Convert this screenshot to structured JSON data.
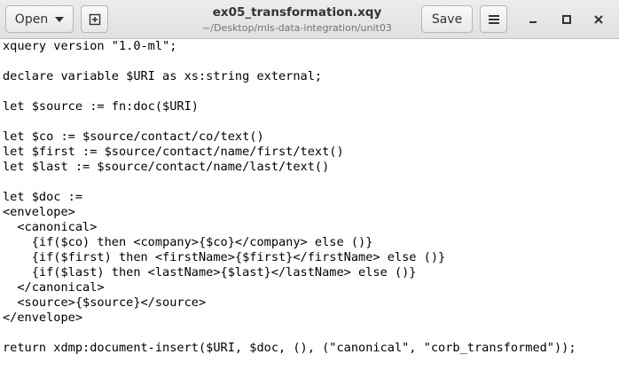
{
  "header": {
    "open_label": "Open",
    "title": "ex05_transformation.xqy",
    "subtitle": "~/Desktop/mls-data-integration/unit03",
    "save_label": "Save"
  },
  "editor": {
    "lines": [
      "xquery version \"1.0-ml\";",
      "",
      "declare variable $URI as xs:string external;",
      "",
      "let $source := fn:doc($URI)",
      "",
      "let $co := $source/contact/co/text()",
      "let $first := $source/contact/name/first/text()",
      "let $last := $source/contact/name/last/text()",
      "",
      "let $doc :=",
      "<envelope>",
      "  <canonical>",
      "    {if($co) then <company>{$co}</company> else ()}",
      "    {if($first) then <firstName>{$first}</firstName> else ()}",
      "    {if($last) then <lastName>{$last}</lastName> else ()}",
      "  </canonical>",
      "  <source>{$source}</source>",
      "</envelope>",
      "",
      "return xdmp:document-insert($URI, $doc, (), (\"canonical\", \"corb_transformed\"));"
    ]
  }
}
